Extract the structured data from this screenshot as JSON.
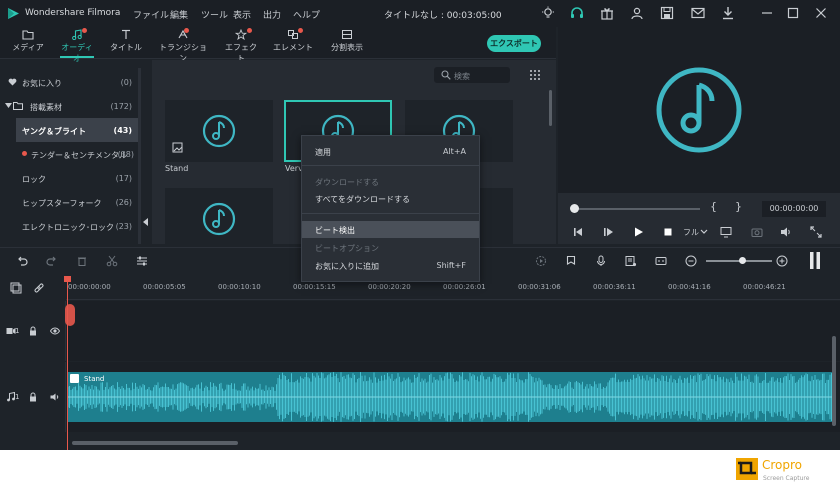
{
  "titlebar": {
    "app_name": "Wondershare Filmora",
    "menu": [
      "ファイル",
      "編集",
      "ツール",
      "表示",
      "出力",
      "ヘルプ"
    ],
    "project_title": "タイトルなし : 00:03:05:00",
    "icons": [
      "bulb-icon",
      "headset-icon",
      "gift-icon",
      "account-icon",
      "save-icon",
      "mail-icon",
      "download-icon",
      "minimize-icon",
      "maximize-icon",
      "close-icon"
    ]
  },
  "toolbar": {
    "tabs": [
      {
        "label": "メディア",
        "icon": "folder-icon"
      },
      {
        "label": "オーディオ",
        "icon": "music-note-icon"
      },
      {
        "label": "タイトル",
        "icon": "text-icon"
      },
      {
        "label": "トランジション",
        "icon": "transition-icon"
      },
      {
        "label": "エフェクト",
        "icon": "effects-icon"
      },
      {
        "label": "エレメント",
        "icon": "elements-icon"
      },
      {
        "label": "分割表示",
        "icon": "split-screen-icon"
      }
    ],
    "active_tab": "オーディオ",
    "export_label": "エクスポート"
  },
  "sidebar": {
    "items": [
      {
        "label": "お気に入り",
        "count": "(0)"
      },
      {
        "label": "搭載素材",
        "count": "(172)"
      },
      {
        "label": "ヤング＆ブライト",
        "count": "(43)"
      },
      {
        "label": "テンダー＆センチメンタル",
        "count": "(38)"
      },
      {
        "label": "ロック",
        "count": "(17)"
      },
      {
        "label": "ヒップスターフォーク",
        "count": "(26)"
      },
      {
        "label": "エレクトロニック･ロック",
        "count": "(23)"
      }
    ]
  },
  "media": {
    "search_placeholder": "検索",
    "tiles": [
      {
        "label": "Stand"
      },
      {
        "label": "Verv"
      },
      {
        "label": ""
      },
      {
        "label": ""
      },
      {
        "label": ""
      },
      {
        "label": ""
      }
    ]
  },
  "context_menu": {
    "items": [
      {
        "label": "適用",
        "shortcut": "Alt+A",
        "disabled": false
      },
      {
        "label": "ダウンロードする",
        "shortcut": "",
        "disabled": true
      },
      {
        "label": "すべてをダウンロードする",
        "shortcut": "",
        "disabled": false
      },
      {
        "label": "ビート検出",
        "shortcut": "",
        "disabled": false
      },
      {
        "label": "ビートオプション",
        "shortcut": "",
        "disabled": true
      },
      {
        "label": "お気に入りに追加",
        "shortcut": "Shift+F",
        "disabled": false
      }
    ]
  },
  "preview": {
    "bracket_in": "{",
    "bracket_out": "}",
    "timecode": "00:00:00:00",
    "quality": "フル"
  },
  "timeline": {
    "ruler": [
      "00:00:00:00",
      "00:00:05:05",
      "00:00:10:10",
      "00:00:15:15",
      "00:00:20:20",
      "00:00:26:01",
      "00:00:31:06",
      "00:00:36:11",
      "00:00:41:16",
      "00:00:46:21"
    ],
    "video_track_label": "1",
    "audio_track_label": "1",
    "audio_clip_name": "Stand"
  },
  "watermark": {
    "name": "Cropro",
    "subtitle": "Screen Capture"
  },
  "colors": {
    "accent": "#2fc7b4",
    "notification": "#e8584c",
    "waveform": "#1e7f8e",
    "background": "#1e2329"
  }
}
